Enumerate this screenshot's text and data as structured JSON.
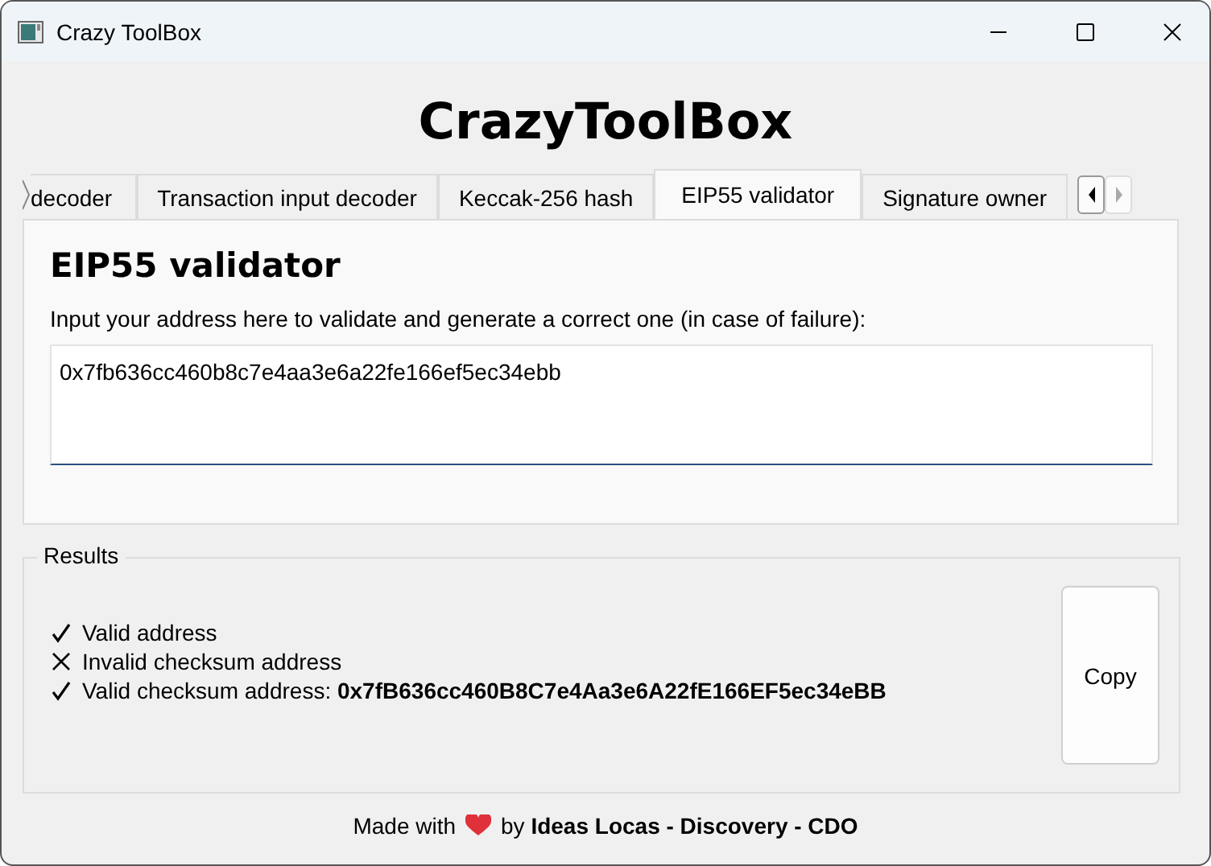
{
  "window": {
    "title": "Crazy ToolBox"
  },
  "heading": "CrazyToolBox",
  "tabs": [
    {
      "label": "decoder",
      "selected": false
    },
    {
      "label": "Transaction input decoder",
      "selected": false
    },
    {
      "label": "Keccak-256 hash",
      "selected": false
    },
    {
      "label": "EIP55 validator",
      "selected": true
    },
    {
      "label": "Signature owner",
      "selected": false
    }
  ],
  "tab_scroll_buttons": [
    {
      "kind": "left",
      "disabled": false
    },
    {
      "kind": "right",
      "disabled": true
    }
  ],
  "panel": {
    "title": "EIP55 validator",
    "prompt": "Input your address here to validate and generate a correct one (in case of failure):",
    "address": "0x7fb636cc460b8c7e4aa3e6a22fe166ef5ec34ebb"
  },
  "results": {
    "title": "Results",
    "lines": [
      {
        "passed": true,
        "text": "Valid address"
      },
      {
        "passed": false,
        "text": "Invalid checksum address"
      },
      {
        "passed": true,
        "text": "Valid checksum address: **0x7fB636cc460B8C7e4Aa3e6A22fE166EF5ec34eBB**"
      }
    ],
    "copy_button": "Copy"
  },
  "footer": {
    "before": "Made with",
    "after": "by **Ideas Locas - Discovery - CDO**"
  }
}
